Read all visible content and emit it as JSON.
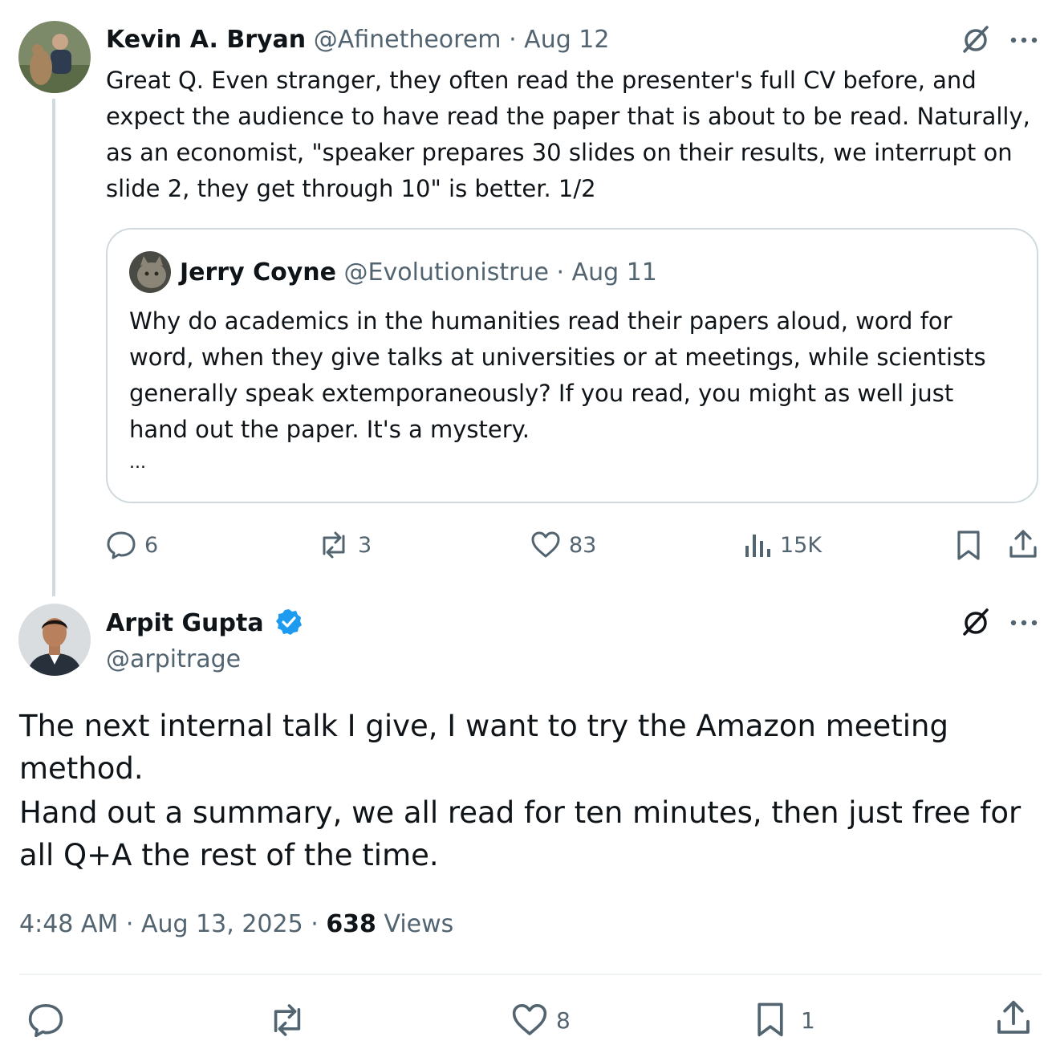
{
  "colors": {
    "text": "#0f1419",
    "muted": "#536471",
    "border": "#cfd9de",
    "verified": "#1d9bf0"
  },
  "reply_tweet": {
    "author_name": "Kevin A. Bryan",
    "handle": "@Afinetheorem",
    "sep": "·",
    "date": "Aug 12",
    "text": "Great Q. Even stranger, they often read the presenter's full CV before, and expect the audience to have read the paper that is about to be read. Naturally, as an economist, \"speaker prepares 30 slides on their results, we interrupt on slide 2, they get through 10\" is better. 1/2",
    "quoted": {
      "author_name": "Jerry Coyne",
      "handle": "@Evolutionistrue",
      "sep": "·",
      "date": "Aug 11",
      "text": "Why do academics in the humanities read their papers aloud, word for word, when they give talks at universities or at meetings, while scientists generally speak extemporaneously? If you read, you might as well just hand out the paper. It's a mystery.",
      "more": "..."
    },
    "actions": {
      "replies": "6",
      "reposts": "3",
      "likes": "83",
      "views": "15K"
    }
  },
  "main_tweet": {
    "author_name": "Arpit Gupta",
    "handle": "@arpitrage",
    "paragraph1": "The next internal talk I give, I want to try the Amazon meeting method.",
    "paragraph2": "Hand out a summary, we all read for ten minutes, then just free for all Q+A the rest of the time.",
    "time": "4:48 AM",
    "sep": "·",
    "date": "Aug 13, 2025",
    "views_count": "638",
    "views_label": "Views",
    "actions": {
      "likes": "8",
      "bookmarks": "1"
    }
  }
}
